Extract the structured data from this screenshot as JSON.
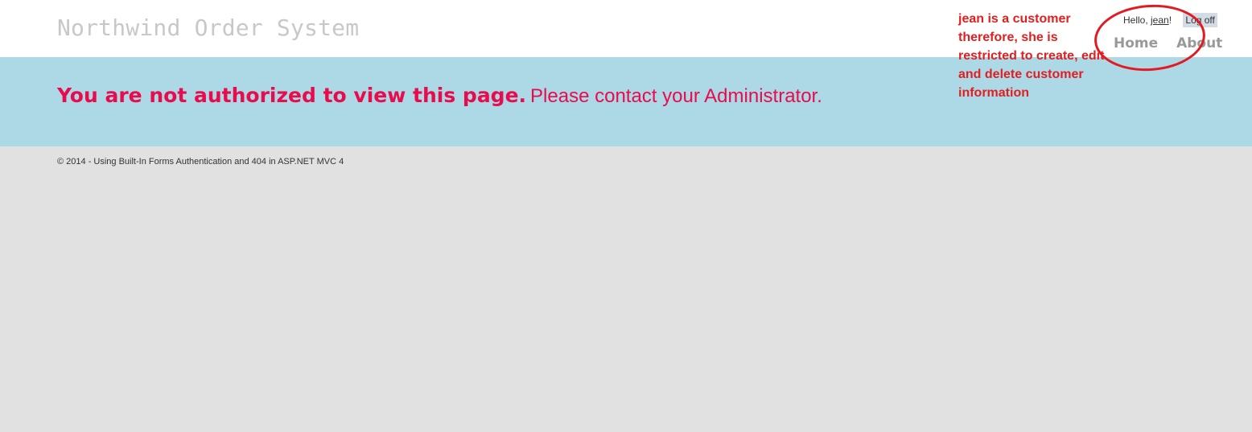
{
  "header": {
    "site_title": "Northwind Order System"
  },
  "login": {
    "greeting_prefix": "Hello, ",
    "username": "jean",
    "greeting_suffix": "!",
    "logoff_label": "Log off"
  },
  "nav": {
    "items": [
      {
        "label": "Home"
      },
      {
        "label": "About"
      }
    ]
  },
  "featured": {
    "message_strong": "You are not authorized to view this page.",
    "message_soft": "Please contact your Administrator."
  },
  "footer": {
    "copyright": "© 2014 - Using Built-In Forms Authentication and 404 in ASP.NET MVC 4"
  },
  "annotation": {
    "text": "jean is a customer therefore, she is restricted to create, edit and delete customer information",
    "color": "#e21b23"
  },
  "colors": {
    "featured_background": "#add8e6",
    "error_text": "#e80c4d",
    "page_background": "#e1e1e1"
  }
}
